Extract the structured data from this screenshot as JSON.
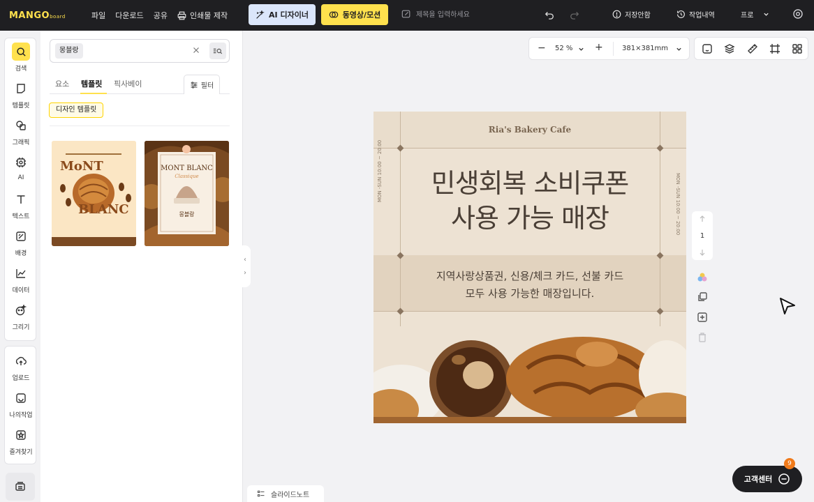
{
  "app": {
    "logo_text": "MANGO",
    "logo_sub": "board"
  },
  "menu": {
    "file": "파일",
    "download": "다운로드",
    "share": "공유",
    "print": "인쇄물 제작"
  },
  "buttons": {
    "ai_designer": "AI 디자이너",
    "video_motion": "동영상/모션",
    "save_history": "저장안함",
    "work_history": "작업내역",
    "plan": "프로"
  },
  "title_input": {
    "placeholder": "제목을 입력하세요"
  },
  "rail": {
    "items": [
      {
        "label": "검색",
        "icon": "search-icon"
      },
      {
        "label": "템플릿",
        "icon": "template-icon"
      },
      {
        "label": "그래픽",
        "icon": "graphic-icon"
      },
      {
        "label": "AI",
        "icon": "ai-icon"
      },
      {
        "label": "텍스트",
        "icon": "text-icon"
      },
      {
        "label": "배경",
        "icon": "background-icon"
      },
      {
        "label": "데이터",
        "icon": "chart-icon"
      },
      {
        "label": "그리기",
        "icon": "draw-icon"
      }
    ],
    "items2": [
      {
        "label": "업로드",
        "icon": "upload-icon"
      },
      {
        "label": "나의작업",
        "icon": "my-work-icon"
      },
      {
        "label": "즐겨찾기",
        "icon": "favorite-icon"
      }
    ]
  },
  "panel": {
    "search_value": "몽블랑",
    "tabs": [
      "요소",
      "템플릿",
      "픽사베이"
    ],
    "active_tab": "템플릿",
    "filter_label": "필터",
    "type_chip": "디자인 템플릿",
    "thumb1": {
      "title_top": "MoNT",
      "title_bottom": "BLANC"
    },
    "thumb2": {
      "title_top": "MONT BLANC",
      "title_sub": "Classique",
      "ko": "몽블랑"
    }
  },
  "zoom": {
    "minus": "−",
    "value": "52 %",
    "plus": "+",
    "size": "381×381mm"
  },
  "artboard": {
    "cafe_name": "Ria's Bakery Cafe",
    "headline_1": "민생회복 소비쿠폰",
    "headline_2": "사용 가능 매장",
    "hours_left": "MON -SUN 10:00 ~ 20:00",
    "hours_right": "MON -SUN 10:00 ~ 20:00",
    "sub_1": "지역사랑상품권, 신용/체크 카드, 선불 카드",
    "sub_2": "모두 사용 가능한 매장입니다."
  },
  "page_control": {
    "page_number": "1"
  },
  "help": {
    "label": "고객센터",
    "badge": "9"
  },
  "slide_note": {
    "label": "슬라이드노트"
  },
  "colors": {
    "topbar": "#1f1f22",
    "accent_yellow": "#ffe14d",
    "ai_button": "#dbe6fb",
    "badge_orange": "#f07a1a"
  }
}
